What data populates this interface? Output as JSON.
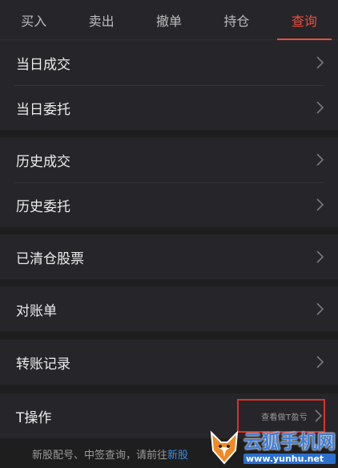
{
  "tabs": [
    {
      "label": "买入",
      "active": false
    },
    {
      "label": "卖出",
      "active": false
    },
    {
      "label": "撤单",
      "active": false
    },
    {
      "label": "持仓",
      "active": false
    },
    {
      "label": "查询",
      "active": true
    }
  ],
  "groups": [
    {
      "items": [
        {
          "label": "当日成交"
        },
        {
          "label": "当日委托"
        }
      ]
    },
    {
      "items": [
        {
          "label": "历史成交"
        },
        {
          "label": "历史委托"
        }
      ]
    },
    {
      "items": [
        {
          "label": "已清仓股票"
        }
      ]
    },
    {
      "items": [
        {
          "label": "对账单"
        }
      ]
    },
    {
      "items": [
        {
          "label": "转账记录"
        }
      ]
    },
    {
      "items": [
        {
          "label": "T操作",
          "hint": "查看做T盈亏"
        }
      ]
    }
  ],
  "footer": {
    "text": "新股配号、中签查询，请前往",
    "link": "新股"
  },
  "watermark": {
    "name": "云狐手机网",
    "url": "www.yunhu.net"
  },
  "colors": {
    "accent": "#f24b3b",
    "background": "#1e1e1f",
    "panel": "#26262a",
    "link": "#3b8fe0",
    "highlight_box": "#e0302c"
  },
  "icons": {
    "row_arrow": "chevron-right-icon"
  }
}
